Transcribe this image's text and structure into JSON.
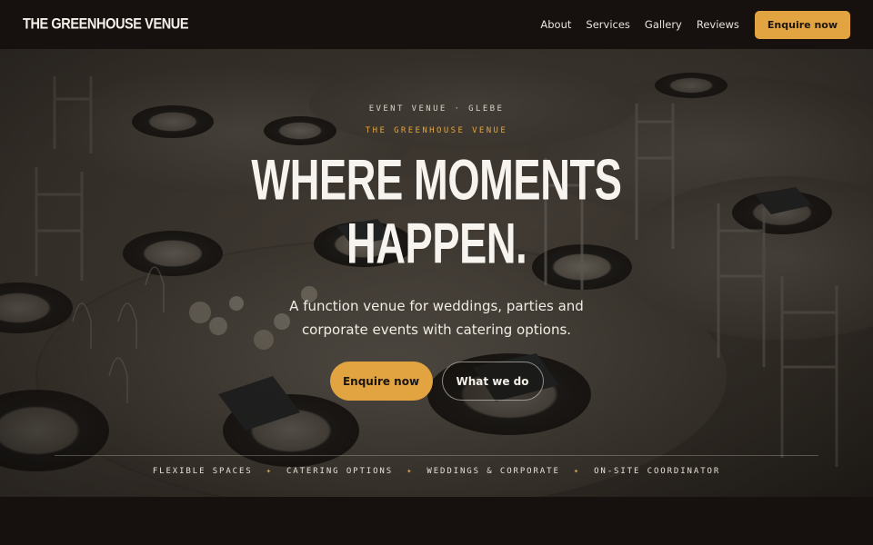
{
  "header": {
    "logo": "THE GREENHOUSE VENUE",
    "nav": [
      "About",
      "Services",
      "Gallery",
      "Reviews"
    ],
    "cta": "Enquire now"
  },
  "hero": {
    "eyebrow": "EVENT VENUE · GLEBE",
    "eyebrow_accent": "THE GREENHOUSE VENUE",
    "headline_line1": "WHERE MOMENTS",
    "headline_line2": "HAPPEN.",
    "subtitle": "A function venue for weddings, parties and corporate events with catering options.",
    "primary_button": "Enquire now",
    "secondary_button": "What we do",
    "background_image": "banquet-tables-photo"
  },
  "features": [
    "FLEXIBLE SPACES",
    "CATERING OPTIONS",
    "WEDDINGS & CORPORATE",
    "ON-SITE COORDINATOR"
  ],
  "feature_separator": "✦",
  "colors": {
    "accent": "#e2a440",
    "background": "#16110e",
    "text": "#f3efe9"
  }
}
